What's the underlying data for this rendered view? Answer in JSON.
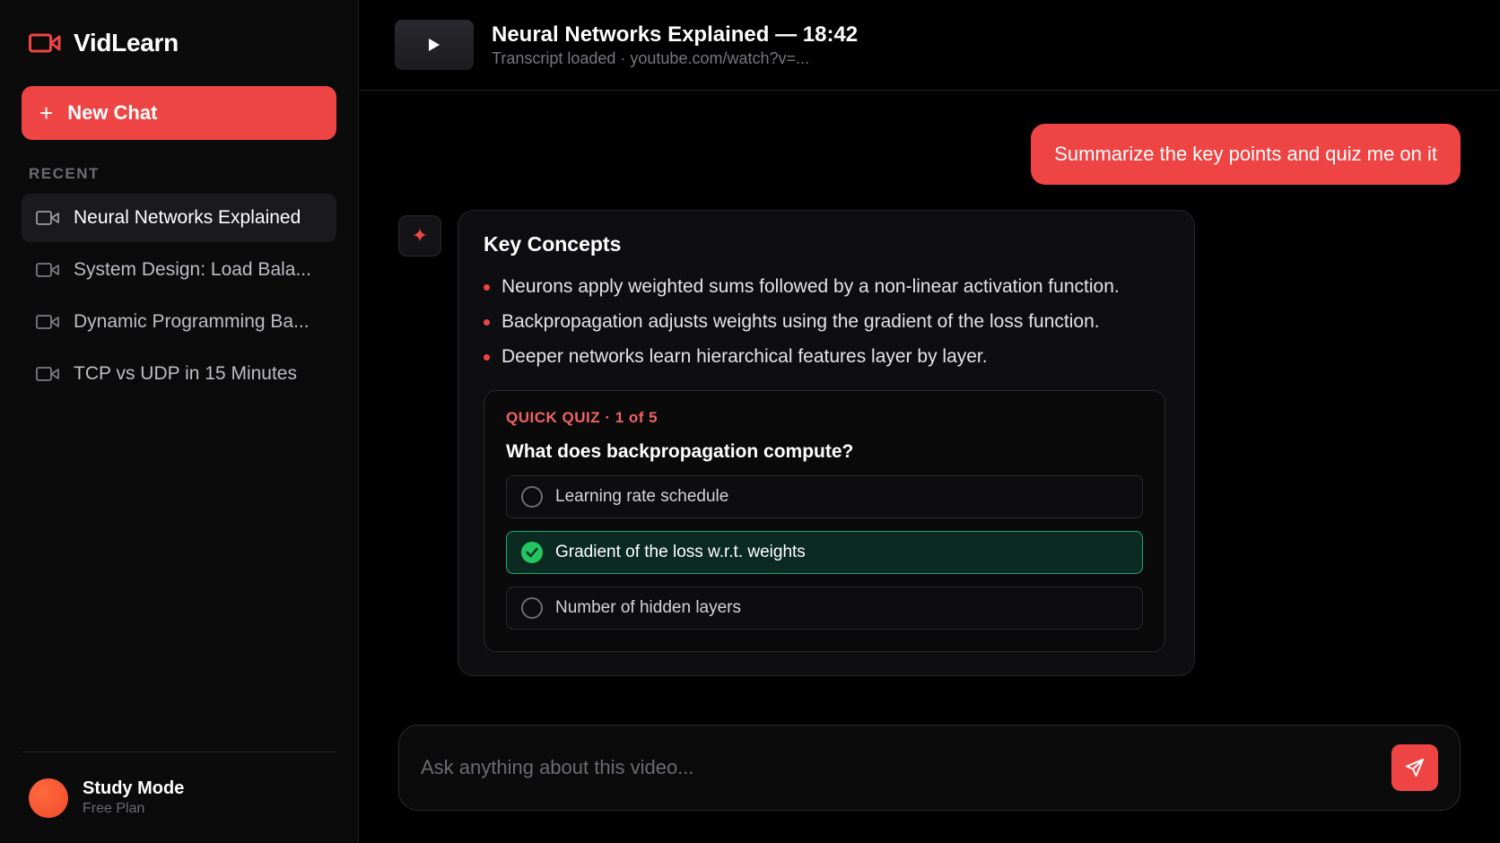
{
  "brand": {
    "name": "VidLearn",
    "accent": "#ef4444"
  },
  "sidebar": {
    "new_chat_label": "New Chat",
    "section_label": "RECENT",
    "items": [
      {
        "label": "Neural Networks Explained",
        "icon": "video-icon",
        "active": true
      },
      {
        "label": "System Design: Load Bala...",
        "icon": "video-icon",
        "active": false
      },
      {
        "label": "Dynamic Programming Ba...",
        "icon": "video-icon",
        "active": false
      },
      {
        "label": "TCP vs UDP in 15 Minutes",
        "icon": "video-icon",
        "active": false
      }
    ],
    "user": {
      "name": "Study Mode",
      "plan": "Free Plan"
    }
  },
  "header": {
    "title": "Neural Networks Explained — 18:42",
    "subtitle": "Transcript loaded · youtube.com/watch?v=..."
  },
  "chat": {
    "user_message": "Summarize the key points and quiz me on it",
    "assistant": {
      "heading": "Key Concepts",
      "bullets": [
        "Neurons apply weighted sums followed by a non-linear activation function.",
        "Backpropagation adjusts weights using the gradient of the loss function.",
        "Deeper networks learn hierarchical features layer by layer."
      ],
      "quiz": {
        "label": "QUICK QUIZ · 1 of 5",
        "question": "What does backpropagation compute?",
        "options": [
          {
            "label": "Learning rate schedule",
            "selected": false
          },
          {
            "label": "Gradient of the loss w.r.t. weights",
            "selected": true
          },
          {
            "label": "Number of hidden layers",
            "selected": false
          }
        ]
      }
    }
  },
  "composer": {
    "placeholder": "Ask anything about this video..."
  }
}
